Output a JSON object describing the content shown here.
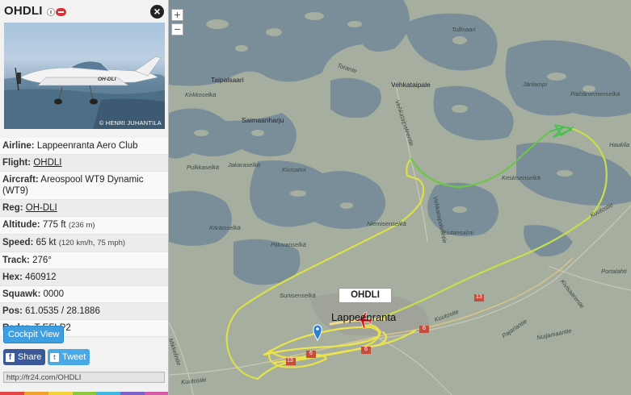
{
  "panel": {
    "title": "OHDLI",
    "photo_credit": "© HENRI JUHANTILA",
    "photo_registration": "OH-DLI",
    "details": {
      "airline_label": "Airline:",
      "airline": "Lappeenranta Aero Club",
      "flight_label": "Flight:",
      "flight": "OHDLI",
      "aircraft_label": "Aircraft:",
      "aircraft": "Areospool WT9 Dynamic (WT9)",
      "reg_label": "Reg:",
      "reg": "OH-DLI",
      "altitude_label": "Altitude:",
      "altitude": "775 ft",
      "altitude_metric": "(236 m)",
      "speed_label": "Speed:",
      "speed": "65 kt",
      "speed_metric": "(120 km/h, 75 mph)",
      "track_label": "Track:",
      "track": "276°",
      "hex_label": "Hex:",
      "hex": "460912",
      "squawk_label": "Squawk:",
      "squawk": "0000",
      "pos_label": "Pos:",
      "pos": "61.0535 / 28.1886",
      "radar_label": "Radar:",
      "radar": "T-EFLP2"
    },
    "cockpit_label": "Cockpit View",
    "share_label": "Share",
    "tweet_label": "Tweet",
    "url": "http://fr24.com/OHDLI",
    "strip_colors": [
      "#e64545",
      "#f0a22e",
      "#f4d23a",
      "#8ec640",
      "#3fb5e0",
      "#7b62c8",
      "#d55aa8"
    ]
  },
  "map": {
    "zoom_in": "+",
    "zoom_out": "−",
    "flight_label": "OHDLI",
    "places": {
      "tullisaari": "Tullisaari",
      "torante": "Torante",
      "vehkataipale": "Vehkataipale",
      "janlampi": "Jänlampi",
      "paihaniemi": "Päihäniemenselkä",
      "taipalsaari": "Taipalsaari",
      "kirkkoselka": "Kirkkoselkä",
      "saimaanharju": "Saimaanharju",
      "vehkataipaleentie1": "Vehkataipaleentie",
      "haukila": "Haukila",
      "pulkkaselka": "Pulkkaselkä",
      "jakaraselka": "Jakaraselkä",
      "kivisalmi": "Kivisalmi",
      "keskisenselka": "Keskisenselkä",
      "vehkataipaleentie2": "Vehkataipaleentie",
      "karaisselka": "Käräisselkä",
      "niemisenselka": "Niemisenselkä",
      "riutansalmi": "Riutansalmi",
      "kuutostie1": "Kuutostie",
      "piiluvanselka": "Piiluvanselkä",
      "sunisenselka": "Sunisenselkä",
      "lappeenranta": "Lappeenranta",
      "kuutostie2": "Kuutostie",
      "portalahti": "Portalahti",
      "kivisaarentie": "Kivisaarentie",
      "pajarlantie": "Pajarlantie",
      "nuijamaantie": "Nuijamaantie",
      "mikkelintie": "Mikkelintie",
      "kuutostie3": "Kuutostie",
      "road_13a": "13",
      "road_13b": "13",
      "road_6a": "6",
      "road_6b": "6",
      "road_6c": "6"
    }
  }
}
